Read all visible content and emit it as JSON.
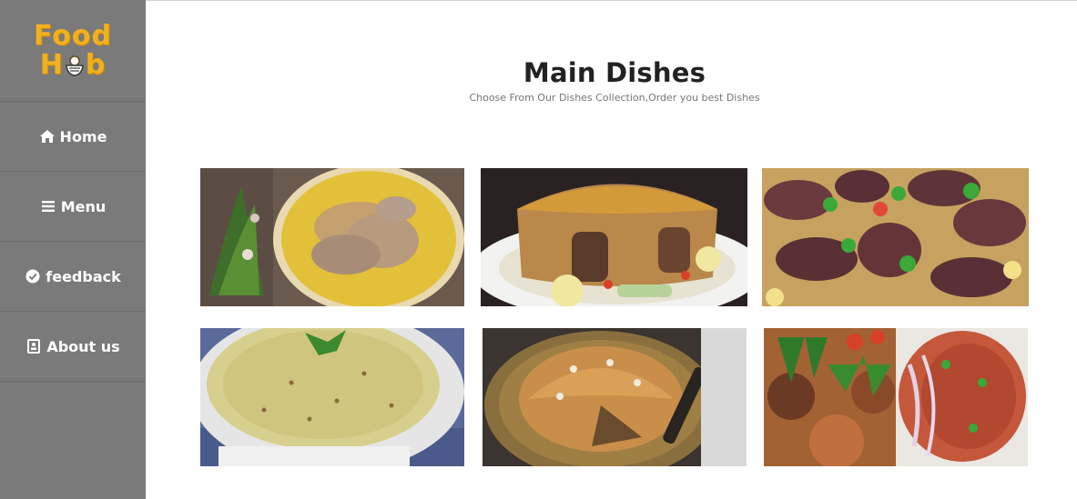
{
  "brand": {
    "line1": "Food",
    "line2_start": "H",
    "line2_end": "b"
  },
  "nav": [
    {
      "label": "Home",
      "icon": "home-icon"
    },
    {
      "label": "Menu",
      "icon": "bars-icon"
    },
    {
      "label": "feedback",
      "icon": "check-circle-icon"
    },
    {
      "label": "About us",
      "icon": "id-card-icon"
    }
  ],
  "main": {
    "title": "Main Dishes",
    "subtitle": "Choose From Our Dishes Collection,Order you best Dishes"
  },
  "dishes": [
    {
      "name": "mansaf-rice-lamb-photo"
    },
    {
      "name": "maqluba-photo"
    },
    {
      "name": "lamb-kabsa-photo"
    },
    {
      "name": "lentil-soup-photo"
    },
    {
      "name": "pastry-pie-photo"
    },
    {
      "name": "kibbeh-salad-photo"
    }
  ],
  "colors": {
    "sidebar": "#7a7a7a",
    "brand": "#f2b01e",
    "text": "#222222",
    "subtitle": "#777777"
  }
}
